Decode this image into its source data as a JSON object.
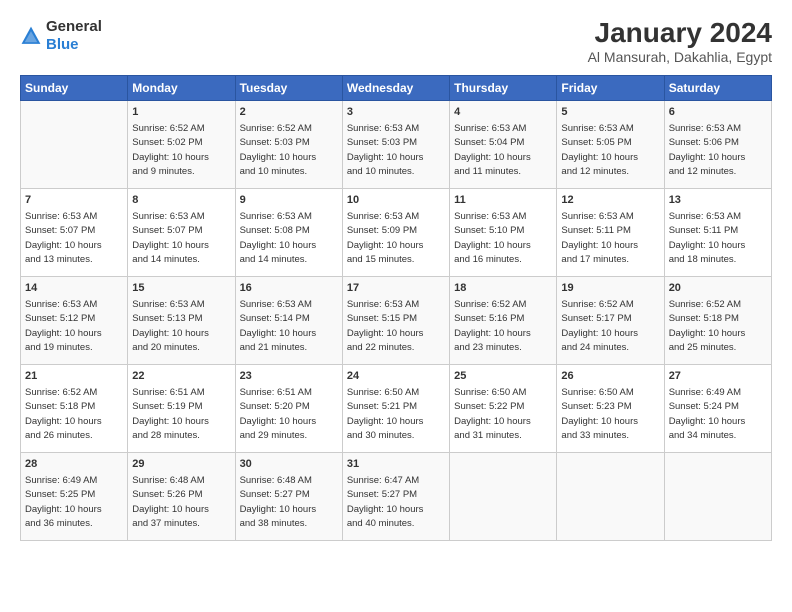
{
  "logo": {
    "general": "General",
    "blue": "Blue"
  },
  "title": "January 2024",
  "subtitle": "Al Mansurah, Dakahlia, Egypt",
  "headers": [
    "Sunday",
    "Monday",
    "Tuesday",
    "Wednesday",
    "Thursday",
    "Friday",
    "Saturday"
  ],
  "weeks": [
    [
      {
        "day": "",
        "info": ""
      },
      {
        "day": "1",
        "info": "Sunrise: 6:52 AM\nSunset: 5:02 PM\nDaylight: 10 hours\nand 9 minutes."
      },
      {
        "day": "2",
        "info": "Sunrise: 6:52 AM\nSunset: 5:03 PM\nDaylight: 10 hours\nand 10 minutes."
      },
      {
        "day": "3",
        "info": "Sunrise: 6:53 AM\nSunset: 5:03 PM\nDaylight: 10 hours\nand 10 minutes."
      },
      {
        "day": "4",
        "info": "Sunrise: 6:53 AM\nSunset: 5:04 PM\nDaylight: 10 hours\nand 11 minutes."
      },
      {
        "day": "5",
        "info": "Sunrise: 6:53 AM\nSunset: 5:05 PM\nDaylight: 10 hours\nand 12 minutes."
      },
      {
        "day": "6",
        "info": "Sunrise: 6:53 AM\nSunset: 5:06 PM\nDaylight: 10 hours\nand 12 minutes."
      }
    ],
    [
      {
        "day": "7",
        "info": "Sunrise: 6:53 AM\nSunset: 5:07 PM\nDaylight: 10 hours\nand 13 minutes."
      },
      {
        "day": "8",
        "info": "Sunrise: 6:53 AM\nSunset: 5:07 PM\nDaylight: 10 hours\nand 14 minutes."
      },
      {
        "day": "9",
        "info": "Sunrise: 6:53 AM\nSunset: 5:08 PM\nDaylight: 10 hours\nand 14 minutes."
      },
      {
        "day": "10",
        "info": "Sunrise: 6:53 AM\nSunset: 5:09 PM\nDaylight: 10 hours\nand 15 minutes."
      },
      {
        "day": "11",
        "info": "Sunrise: 6:53 AM\nSunset: 5:10 PM\nDaylight: 10 hours\nand 16 minutes."
      },
      {
        "day": "12",
        "info": "Sunrise: 6:53 AM\nSunset: 5:11 PM\nDaylight: 10 hours\nand 17 minutes."
      },
      {
        "day": "13",
        "info": "Sunrise: 6:53 AM\nSunset: 5:11 PM\nDaylight: 10 hours\nand 18 minutes."
      }
    ],
    [
      {
        "day": "14",
        "info": "Sunrise: 6:53 AM\nSunset: 5:12 PM\nDaylight: 10 hours\nand 19 minutes."
      },
      {
        "day": "15",
        "info": "Sunrise: 6:53 AM\nSunset: 5:13 PM\nDaylight: 10 hours\nand 20 minutes."
      },
      {
        "day": "16",
        "info": "Sunrise: 6:53 AM\nSunset: 5:14 PM\nDaylight: 10 hours\nand 21 minutes."
      },
      {
        "day": "17",
        "info": "Sunrise: 6:53 AM\nSunset: 5:15 PM\nDaylight: 10 hours\nand 22 minutes."
      },
      {
        "day": "18",
        "info": "Sunrise: 6:52 AM\nSunset: 5:16 PM\nDaylight: 10 hours\nand 23 minutes."
      },
      {
        "day": "19",
        "info": "Sunrise: 6:52 AM\nSunset: 5:17 PM\nDaylight: 10 hours\nand 24 minutes."
      },
      {
        "day": "20",
        "info": "Sunrise: 6:52 AM\nSunset: 5:18 PM\nDaylight: 10 hours\nand 25 minutes."
      }
    ],
    [
      {
        "day": "21",
        "info": "Sunrise: 6:52 AM\nSunset: 5:18 PM\nDaylight: 10 hours\nand 26 minutes."
      },
      {
        "day": "22",
        "info": "Sunrise: 6:51 AM\nSunset: 5:19 PM\nDaylight: 10 hours\nand 28 minutes."
      },
      {
        "day": "23",
        "info": "Sunrise: 6:51 AM\nSunset: 5:20 PM\nDaylight: 10 hours\nand 29 minutes."
      },
      {
        "day": "24",
        "info": "Sunrise: 6:50 AM\nSunset: 5:21 PM\nDaylight: 10 hours\nand 30 minutes."
      },
      {
        "day": "25",
        "info": "Sunrise: 6:50 AM\nSunset: 5:22 PM\nDaylight: 10 hours\nand 31 minutes."
      },
      {
        "day": "26",
        "info": "Sunrise: 6:50 AM\nSunset: 5:23 PM\nDaylight: 10 hours\nand 33 minutes."
      },
      {
        "day": "27",
        "info": "Sunrise: 6:49 AM\nSunset: 5:24 PM\nDaylight: 10 hours\nand 34 minutes."
      }
    ],
    [
      {
        "day": "28",
        "info": "Sunrise: 6:49 AM\nSunset: 5:25 PM\nDaylight: 10 hours\nand 36 minutes."
      },
      {
        "day": "29",
        "info": "Sunrise: 6:48 AM\nSunset: 5:26 PM\nDaylight: 10 hours\nand 37 minutes."
      },
      {
        "day": "30",
        "info": "Sunrise: 6:48 AM\nSunset: 5:27 PM\nDaylight: 10 hours\nand 38 minutes."
      },
      {
        "day": "31",
        "info": "Sunrise: 6:47 AM\nSunset: 5:27 PM\nDaylight: 10 hours\nand 40 minutes."
      },
      {
        "day": "",
        "info": ""
      },
      {
        "day": "",
        "info": ""
      },
      {
        "day": "",
        "info": ""
      }
    ]
  ]
}
